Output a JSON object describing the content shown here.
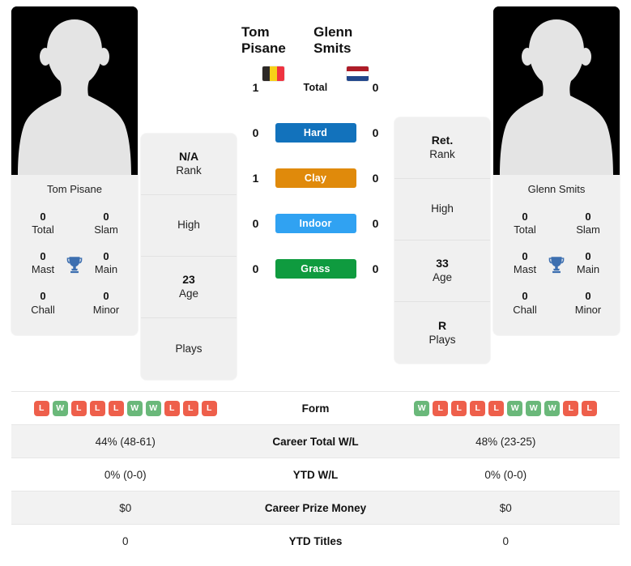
{
  "players": {
    "left": {
      "name": "Tom Pisane",
      "photo_name": "Tom Pisane",
      "country": "Belgium",
      "flag": "flag-belgium",
      "rank": "N/A",
      "rank_label": "Rank",
      "high": "",
      "high_label": "High",
      "age": "23",
      "age_label": "Age",
      "plays": "",
      "plays_label": "Plays",
      "titles": {
        "total": "0",
        "total_label": "Total",
        "slam": "0",
        "slam_label": "Slam",
        "mast": "0",
        "mast_label": "Mast",
        "main": "0",
        "main_label": "Main",
        "chall": "0",
        "chall_label": "Chall",
        "minor": "0",
        "minor_label": "Minor"
      },
      "form": [
        "L",
        "W",
        "L",
        "L",
        "L",
        "W",
        "W",
        "L",
        "L",
        "L"
      ],
      "career_wl": "44% (48-61)",
      "ytd_wl": "0% (0-0)",
      "career_prize": "$0",
      "ytd_titles": "0"
    },
    "right": {
      "name": "Glenn Smits",
      "photo_name": "Glenn Smits",
      "country": "Netherlands",
      "flag": "flag-netherlands",
      "rank": "Ret.",
      "rank_label": "Rank",
      "high": "",
      "high_label": "High",
      "age": "33",
      "age_label": "Age",
      "plays": "R",
      "plays_label": "Plays",
      "titles": {
        "total": "0",
        "total_label": "Total",
        "slam": "0",
        "slam_label": "Slam",
        "mast": "0",
        "mast_label": "Mast",
        "main": "0",
        "main_label": "Main",
        "chall": "0",
        "chall_label": "Chall",
        "minor": "0",
        "minor_label": "Minor"
      },
      "form": [
        "W",
        "L",
        "L",
        "L",
        "L",
        "W",
        "W",
        "W",
        "L",
        "L"
      ],
      "career_wl": "48% (23-25)",
      "ytd_wl": "0% (0-0)",
      "career_prize": "$0",
      "ytd_titles": "0"
    }
  },
  "head_to_head": [
    {
      "label": "Total",
      "left": "1",
      "right": "0",
      "color": "",
      "style": "plain"
    },
    {
      "label": "Hard",
      "left": "0",
      "right": "0",
      "color": "#1272bc",
      "style": "badge"
    },
    {
      "label": "Clay",
      "left": "1",
      "right": "0",
      "color": "#e08a0b",
      "style": "badge"
    },
    {
      "label": "Indoor",
      "left": "0",
      "right": "0",
      "color": "#30a2f2",
      "style": "badge"
    },
    {
      "label": "Grass",
      "left": "0",
      "right": "0",
      "color": "#0f9b3f",
      "style": "badge"
    }
  ],
  "table_rows": [
    {
      "label": "Form",
      "type": "form"
    },
    {
      "label": "Career Total W/L",
      "type": "text",
      "key": "career_wl"
    },
    {
      "label": "YTD W/L",
      "type": "text",
      "key": "ytd_wl"
    },
    {
      "label": "Career Prize Money",
      "type": "text",
      "key": "career_prize"
    },
    {
      "label": "YTD Titles",
      "type": "text",
      "key": "ytd_titles"
    }
  ],
  "colors": {
    "win_badge": "#6ab87a",
    "loss_badge": "#ee5f4b",
    "trophy": "#3d6fb0",
    "card_bg": "#f0f0f0",
    "row_alt": "#f2f2f2"
  },
  "badge_letters": {
    "win": "W",
    "loss": "L"
  }
}
